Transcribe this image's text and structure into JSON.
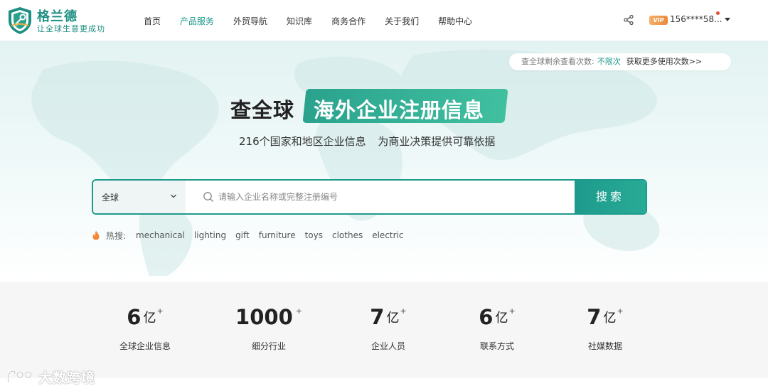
{
  "brand": {
    "name": "格兰德",
    "slogan": "让全球生意更成功"
  },
  "nav": {
    "items": [
      {
        "label": "首页",
        "active": false
      },
      {
        "label": "产品服务",
        "active": true
      },
      {
        "label": "外贸导航",
        "active": false
      },
      {
        "label": "知识库",
        "active": false
      },
      {
        "label": "商务合作",
        "active": false
      },
      {
        "label": "关于我们",
        "active": false
      },
      {
        "label": "帮助中心",
        "active": false
      }
    ]
  },
  "user": {
    "vip_badge": "VIP",
    "phone": "156****58...",
    "has_notification": true,
    "icons": [
      "share-icon",
      "chevron-down-icon"
    ]
  },
  "quota": {
    "label": "查全球剩余查看次数:",
    "value": "不限次",
    "more_link": "获取更多使用次数>>"
  },
  "hero": {
    "title_prefix": "查全球",
    "title_main": "海外企业注册信息",
    "subtitle": "216个国家和地区企业信息 为商业决策提供可靠依据"
  },
  "search": {
    "region": "全球",
    "placeholder": "请输入企业名称或完整注册编号",
    "value": "",
    "button_label": "搜索"
  },
  "hot": {
    "label": "热搜:",
    "tags": [
      "mechanical",
      "lighting",
      "gift",
      "furniture",
      "toys",
      "clothes",
      "electric"
    ]
  },
  "stats": [
    {
      "value": "6",
      "unit": "亿",
      "plus": "+",
      "label": "全球企业信息"
    },
    {
      "value": "1000",
      "unit": "",
      "plus": "+",
      "label": "细分行业"
    },
    {
      "value": "7",
      "unit": "亿",
      "plus": "+",
      "label": "企业人员"
    },
    {
      "value": "6",
      "unit": "亿",
      "plus": "+",
      "label": "联系方式"
    },
    {
      "value": "7",
      "unit": "亿",
      "plus": "+",
      "label": "社媒数据"
    }
  ],
  "watermark": {
    "text": "大数跨境"
  },
  "colors": {
    "brand": "#1e9a8c",
    "accent_gradient_end": "#41c0a0",
    "vip": "#e98a3e",
    "notification": "#e74c3c",
    "stats_bg": "#f6f6f6"
  }
}
